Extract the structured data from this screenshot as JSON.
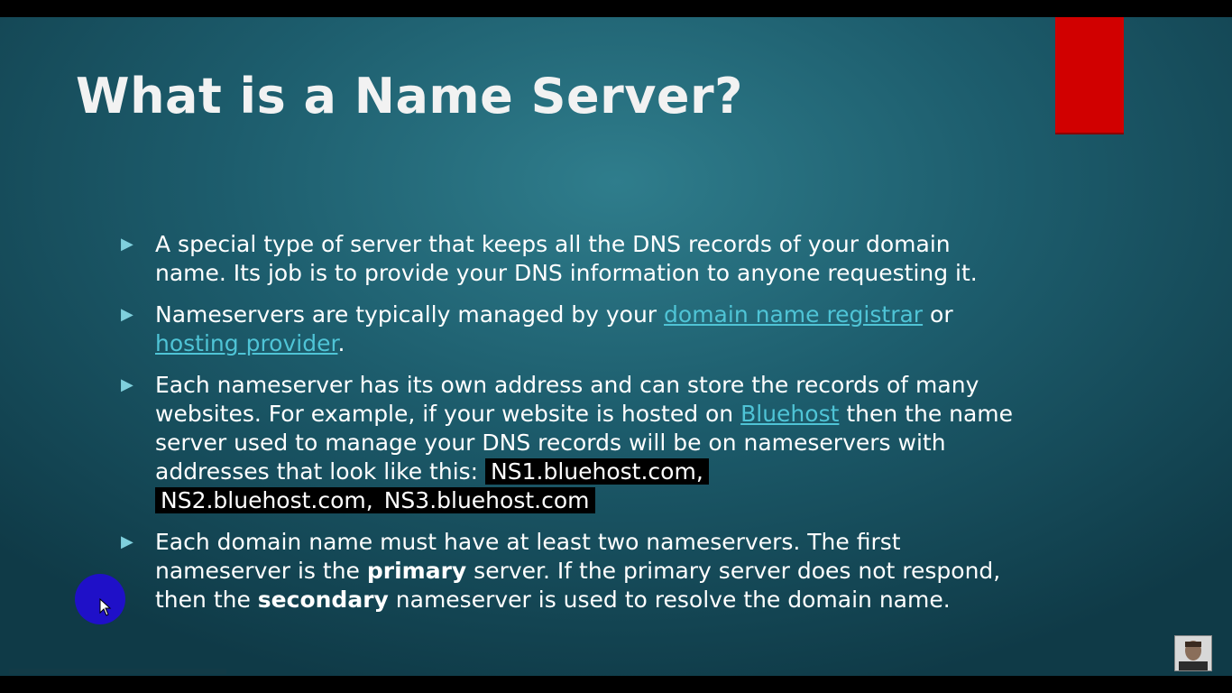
{
  "slide": {
    "title": "What is a Name Server?",
    "bullets": [
      {
        "text": "A special type of server that keeps all the DNS records of your domain name. Its job is to provide your DNS information to anyone requesting it."
      },
      {
        "pre": "Nameservers are typically managed by your ",
        "link1": "domain name registrar",
        "mid": " or ",
        "link2": "hosting provider",
        "post": "."
      },
      {
        "pre": "Each nameserver has its own address and can store the records of many websites. For example, if your website is hosted on ",
        "link": "Bluehost",
        "mid": " then the name server used to manage your DNS records will be on nameservers with addresses that look like this: ",
        "hl1": "NS1.bluehost.com,",
        "hl2": "NS2.bluehost.com,",
        "hl3": "NS3.bluehost.com"
      },
      {
        "pre": "Each domain name must have at least two nameservers. The first nameserver is the ",
        "bold1": "primary",
        "mid": " server. If the primary server does not respond, then the ",
        "bold2": "secondary",
        "post": " nameserver is used to resolve the domain name."
      }
    ]
  },
  "icons": {
    "bullet": "play-arrow-icon",
    "cursor": "mouse-pointer-icon",
    "webcam": "presenter-avatar"
  },
  "colors": {
    "accent_red": "#d10000",
    "link": "#4fc4d6",
    "cursor_highlight": "#1f10c8"
  }
}
